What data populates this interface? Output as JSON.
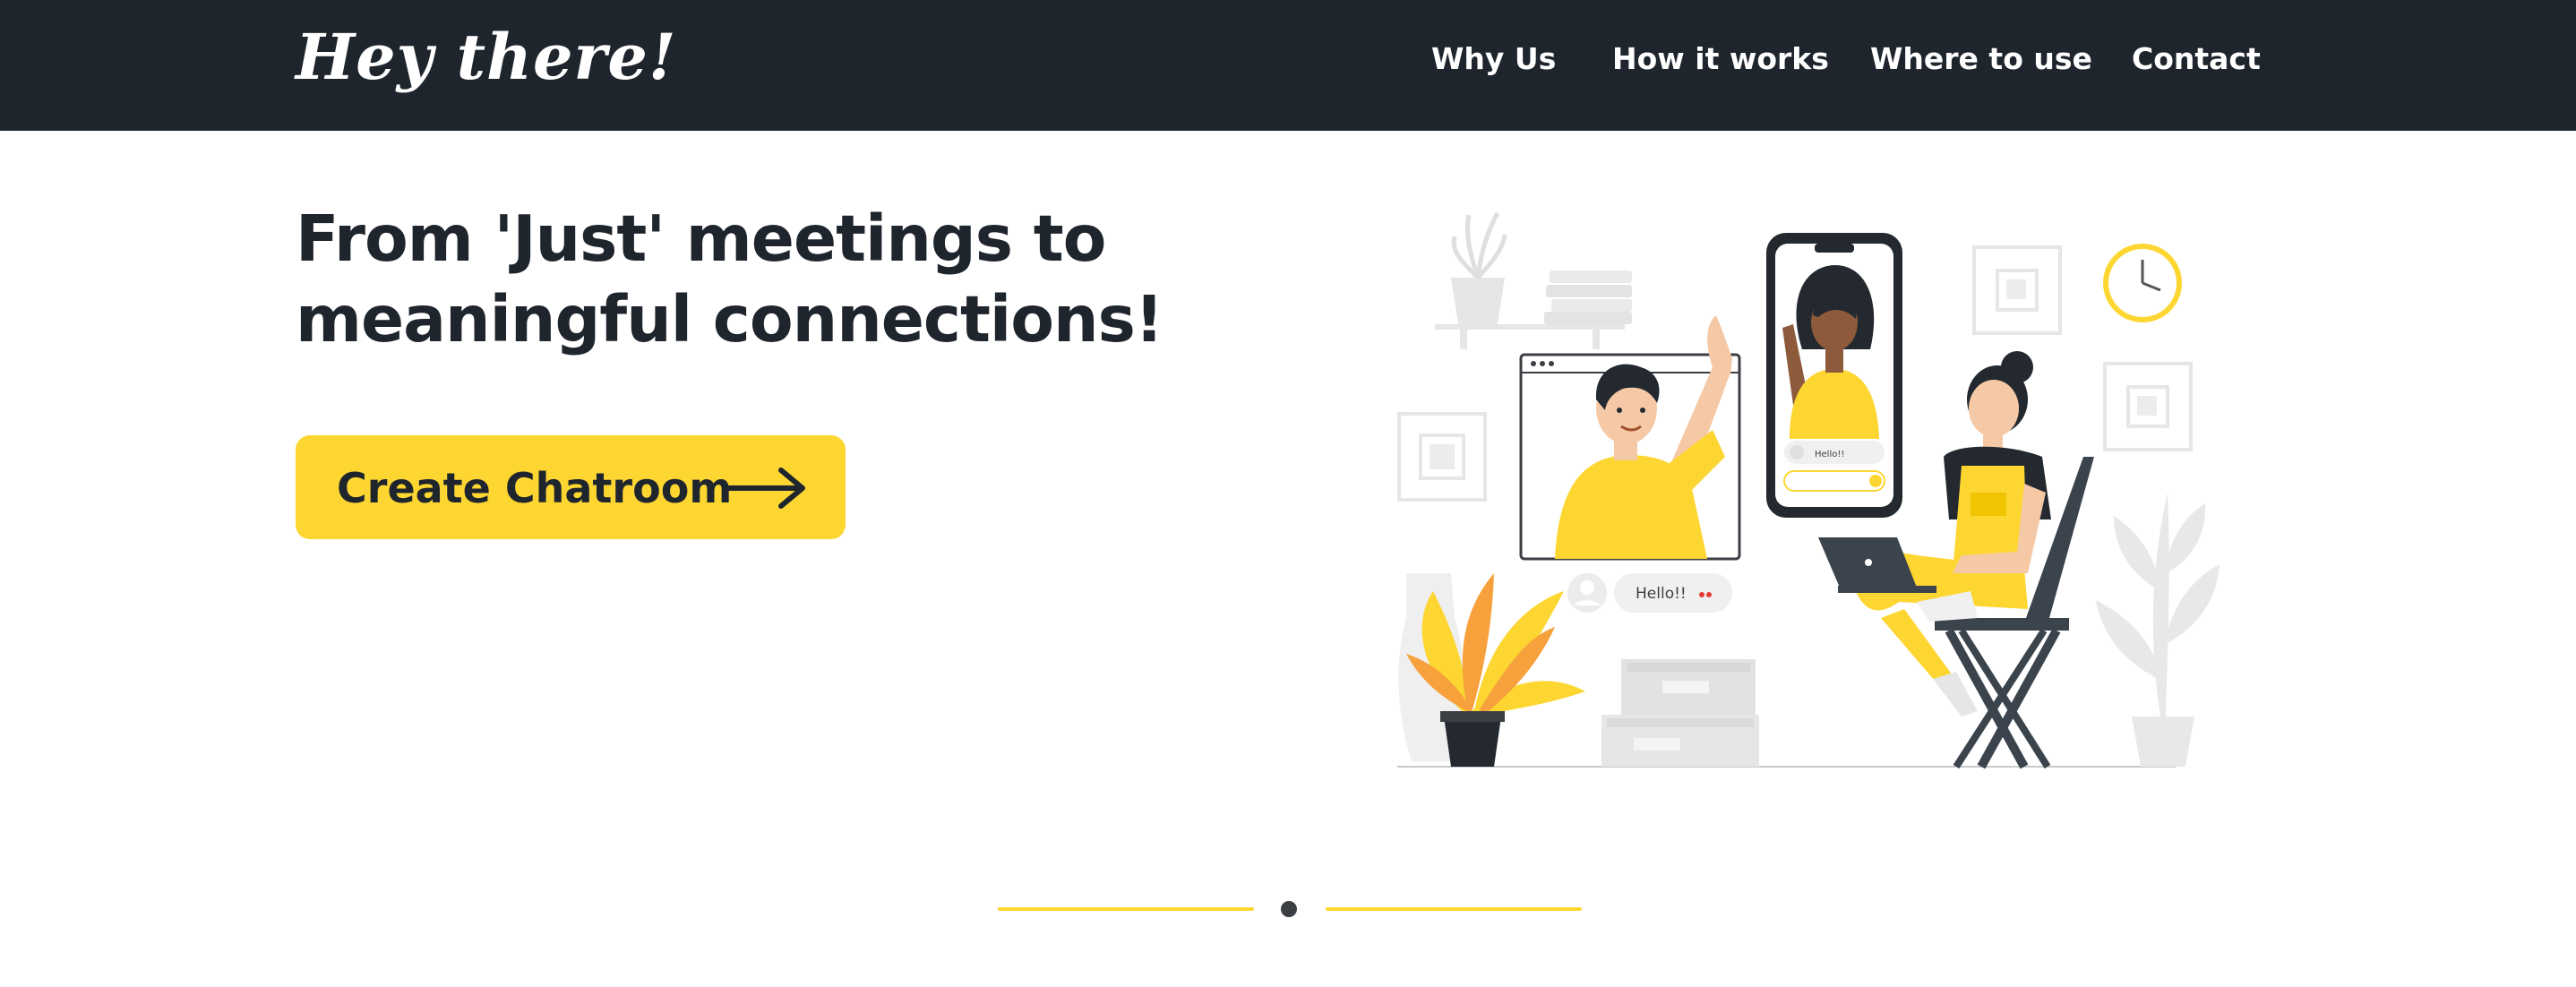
{
  "navbar": {
    "brand": "Hey there!",
    "links": [
      "Why Us",
      "How it works",
      "Where to use",
      "Contact"
    ]
  },
  "hero": {
    "headline_line1": "From 'Just' meetings to",
    "headline_line2": "meaningful connections!",
    "cta_label": "Create Chatroom"
  },
  "illustration": {
    "chat_bubble": "Hello!!",
    "phone_bubble": "Hello!!"
  },
  "carousel": {
    "active_index": 1,
    "count": 1
  },
  "colors": {
    "navbar_bg": "#1f252d",
    "accent": "#fdd632",
    "text_dark": "#1f252d"
  }
}
